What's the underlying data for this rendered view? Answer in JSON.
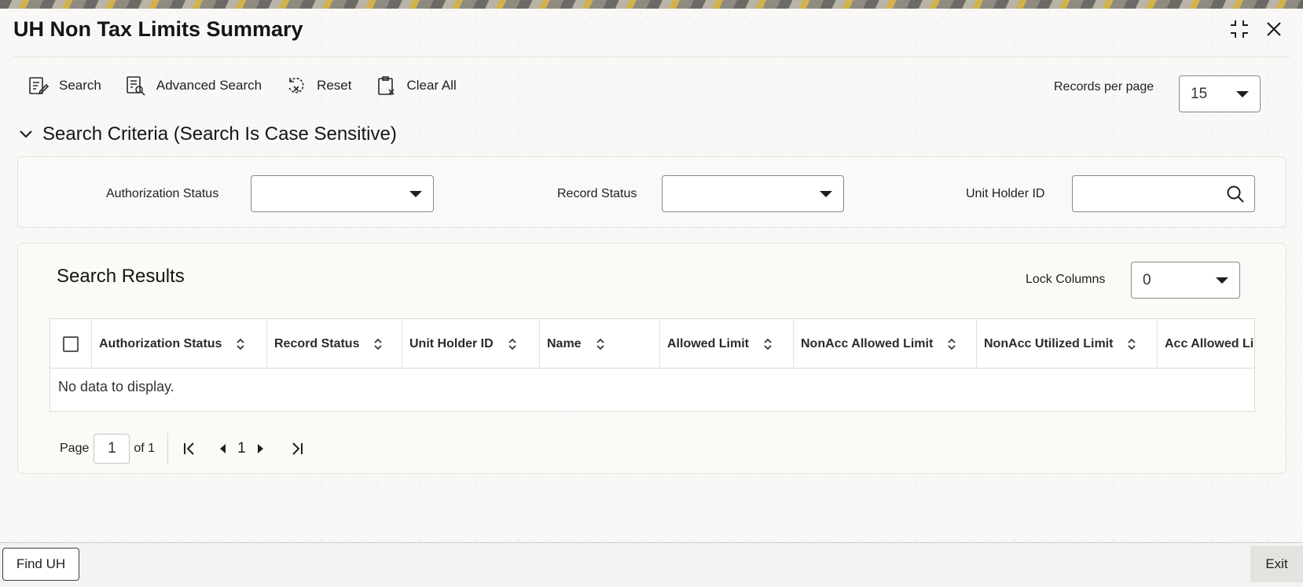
{
  "window": {
    "title": "UH Non Tax Limits Summary",
    "icons": {
      "maximize": "collapse-icon",
      "close": "close-icon"
    }
  },
  "toolbar": {
    "search": "Search",
    "advanced_search": "Advanced Search",
    "reset": "Reset",
    "clear_all": "Clear All",
    "records_per_page_label": "Records per page",
    "records_per_page_value": "15"
  },
  "criteria": {
    "header": "Search Criteria (Search Is Case Sensitive)",
    "authorization_status_label": "Authorization Status",
    "authorization_status_value": "",
    "record_status_label": "Record Status",
    "record_status_value": "",
    "unit_holder_id_label": "Unit Holder ID",
    "unit_holder_id_value": ""
  },
  "results": {
    "title": "Search Results",
    "lock_columns_label": "Lock Columns",
    "lock_columns_value": "0",
    "columns": [
      "Authorization Status",
      "Record Status",
      "Unit Holder ID",
      "Name",
      "Allowed Limit",
      "NonAcc Allowed Limit",
      "NonAcc Utilized Limit",
      "Acc Allowed Lin"
    ],
    "empty_message": "No data to display."
  },
  "pagination": {
    "page_label": "Page",
    "current_page": "1",
    "of_label": "of 1",
    "page_number": "1"
  },
  "footer": {
    "find_uh": "Find UH",
    "exit": "Exit"
  },
  "colors": {
    "text": "#1f1f1f",
    "border": "#8a8886",
    "panel": "#faf9f7"
  }
}
